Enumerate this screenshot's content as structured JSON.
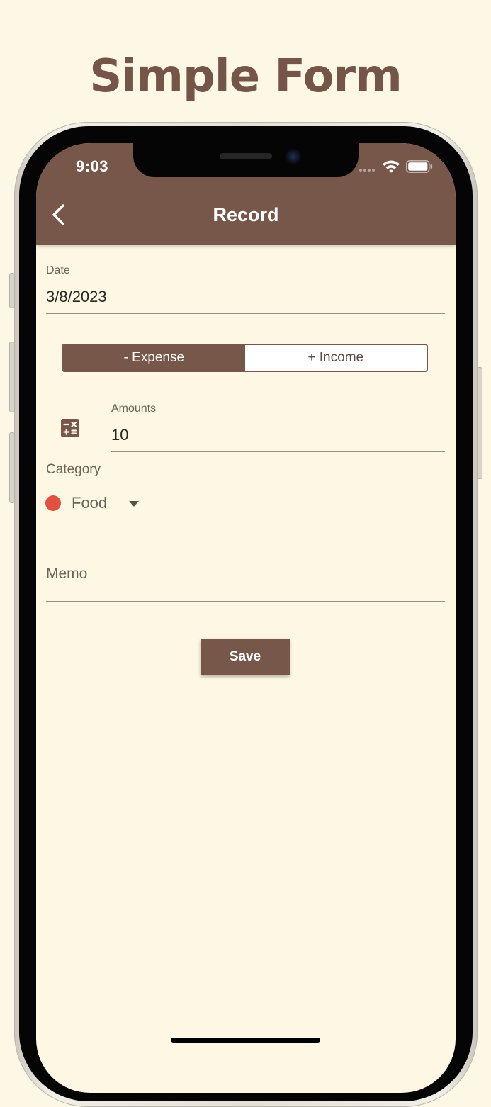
{
  "promo": {
    "title": "Simple Form"
  },
  "status_bar": {
    "time": "9:03",
    "icons": [
      "signal-dots-icon",
      "wifi-icon",
      "battery-icon"
    ]
  },
  "header": {
    "title": "Record",
    "back_icon": "chevron-left-icon"
  },
  "form": {
    "date": {
      "label": "Date",
      "value": "3/8/2023"
    },
    "type_toggle": {
      "expense_label": "- Expense",
      "income_label": "+ Income",
      "selected": "expense"
    },
    "amount": {
      "label": "Amounts",
      "value": "10",
      "icon": "calculator-icon"
    },
    "category": {
      "label": "Category",
      "value": "Food",
      "dot_color": "#e0513f",
      "icon": "dropdown-arrow-icon"
    },
    "memo": {
      "placeholder": "Memo"
    },
    "save_label": "Save"
  },
  "colors": {
    "primary": "#775749",
    "background": "#fdf7e3",
    "title": "#755548"
  }
}
